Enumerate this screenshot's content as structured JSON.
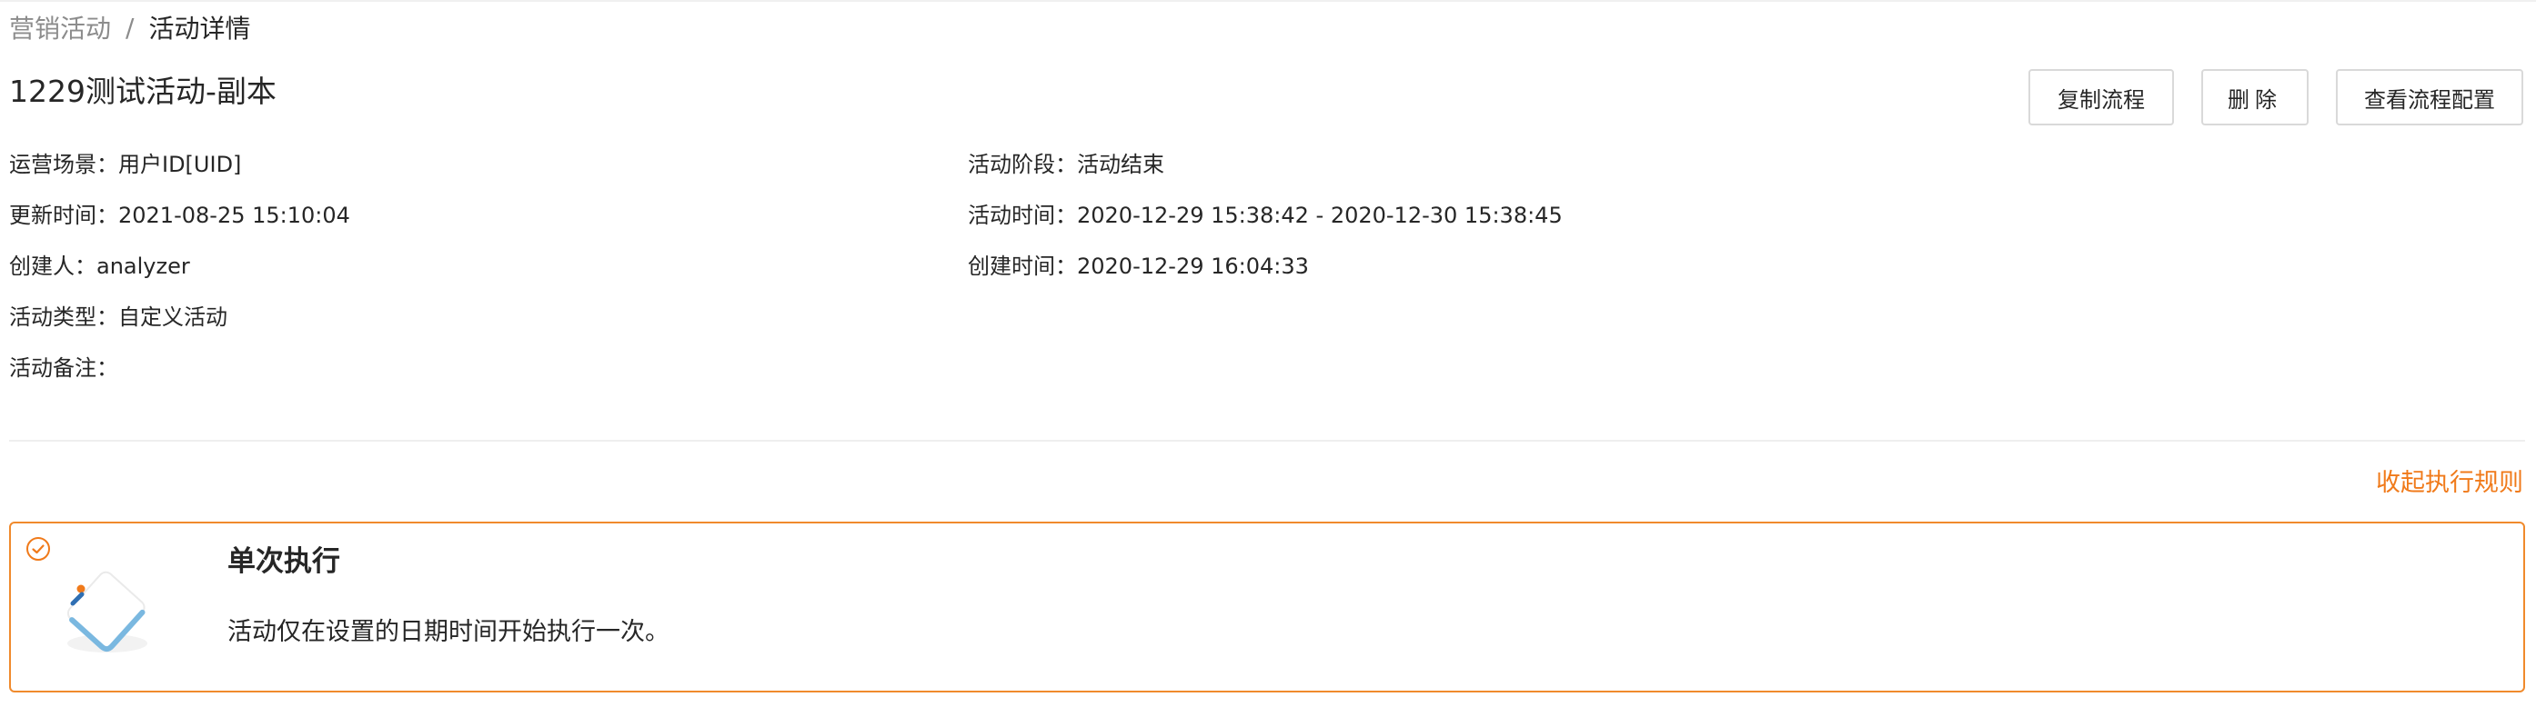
{
  "breadcrumb": {
    "parent": "营销活动",
    "separator": "/",
    "current": "活动详情"
  },
  "activity": {
    "title": "1229测试活动-副本"
  },
  "actions": {
    "copy_flow": "复制流程",
    "delete": "删除",
    "view_flow_config": "查看流程配置"
  },
  "details": {
    "scenario": {
      "label": "运营场景：",
      "value": "用户ID[UID]"
    },
    "stage": {
      "label": "活动阶段：",
      "value": "活动结束"
    },
    "updated_at": {
      "label": "更新时间：",
      "value": "2021-08-25 15:10:04"
    },
    "period": {
      "label": "活动时间：",
      "value": "2020-12-29 15:38:42 - 2020-12-30 15:38:45"
    },
    "creator": {
      "label": "创建人：",
      "value": "analyzer"
    },
    "created_at": {
      "label": "创建时间：",
      "value": "2020-12-29 16:04:33"
    },
    "type": {
      "label": "活动类型：",
      "value": "自定义活动"
    },
    "remark": {
      "label": "活动备注：",
      "value": ""
    }
  },
  "execution_rules": {
    "collapse_label": "收起执行规则",
    "selected_rule": {
      "title": "单次执行",
      "description": "活动仅在设置的日期时间开始执行一次。",
      "icon": "check-circle-icon"
    }
  },
  "colors": {
    "accent": "#f07a1a",
    "border_selected": "#f08a2c",
    "text": "#262626",
    "muted": "#8c8c8c"
  }
}
